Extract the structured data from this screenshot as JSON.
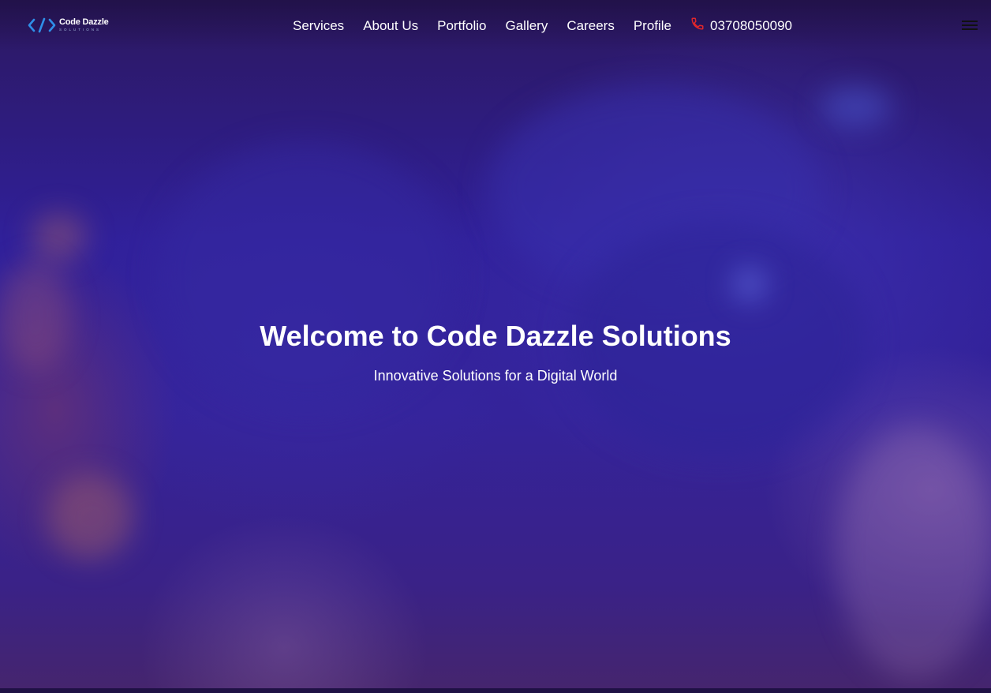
{
  "brand": {
    "name": "Code Dazzle",
    "tagline": "SOLUTIONS",
    "logo_icon": "code-brackets-icon",
    "accent_color": "#2f8fe8"
  },
  "nav": {
    "items": [
      {
        "label": "Services"
      },
      {
        "label": "About Us"
      },
      {
        "label": "Portfolio"
      },
      {
        "label": "Gallery"
      },
      {
        "label": "Careers"
      },
      {
        "label": "Profile"
      }
    ],
    "phone": {
      "icon": "phone-icon",
      "icon_color": "#e0262b",
      "number": "03708050090"
    },
    "menu_icon": "hamburger-menu-icon"
  },
  "hero": {
    "title": "Welcome to Code Dazzle Solutions",
    "subtitle": "Innovative Solutions for a Digital World",
    "background_color": "#30209a"
  }
}
